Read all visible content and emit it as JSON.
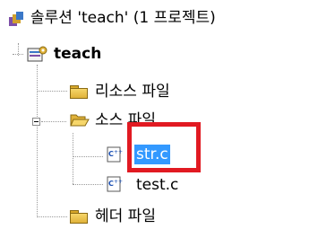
{
  "tree": {
    "solution_label": "솔루션 'teach' (1 프로젝트)",
    "project_label": "teach",
    "resource_folder": "리소스 파일",
    "source_folder": "소스 파일",
    "file_str": "str.c",
    "file_test": "test.c",
    "header_folder": "헤더 파일",
    "cpp_icon_glyph": "C++"
  },
  "colors": {
    "selection": "#3399ff",
    "highlight_box": "#e11a22"
  }
}
